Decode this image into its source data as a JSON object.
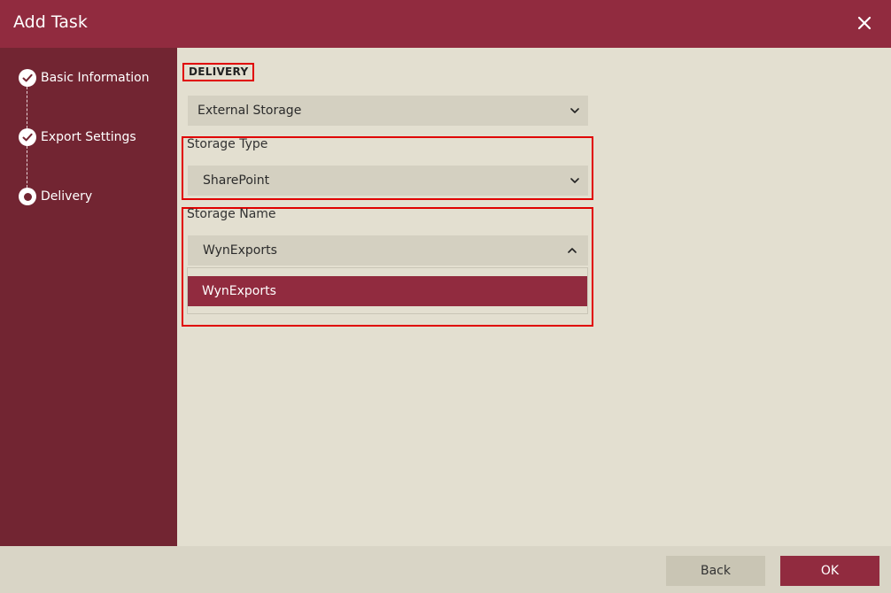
{
  "dialog": {
    "title": "Add Task"
  },
  "steps": [
    {
      "label": "Basic Information",
      "state": "done"
    },
    {
      "label": "Export Settings",
      "state": "done"
    },
    {
      "label": "Delivery",
      "state": "current"
    }
  ],
  "delivery": {
    "section_title": "DELIVERY",
    "delivery_type": "External Storage",
    "storage_type_label": "Storage Type",
    "storage_type": "SharePoint",
    "storage_name_label": "Storage Name",
    "storage_name": "WynExports",
    "storage_name_options": [
      "WynExports"
    ]
  },
  "footer": {
    "back_label": "Back",
    "ok_label": "OK"
  },
  "colors": {
    "accent": "#912b3f",
    "sidebar": "#722532",
    "background": "#e3dfd0",
    "highlight": "#e00000"
  },
  "icons": {
    "close": "close-icon",
    "step_done": "check-icon",
    "step_current": "radio-dot-icon",
    "select": "chevron-down-icon",
    "select_open": "chevron-up-icon"
  }
}
